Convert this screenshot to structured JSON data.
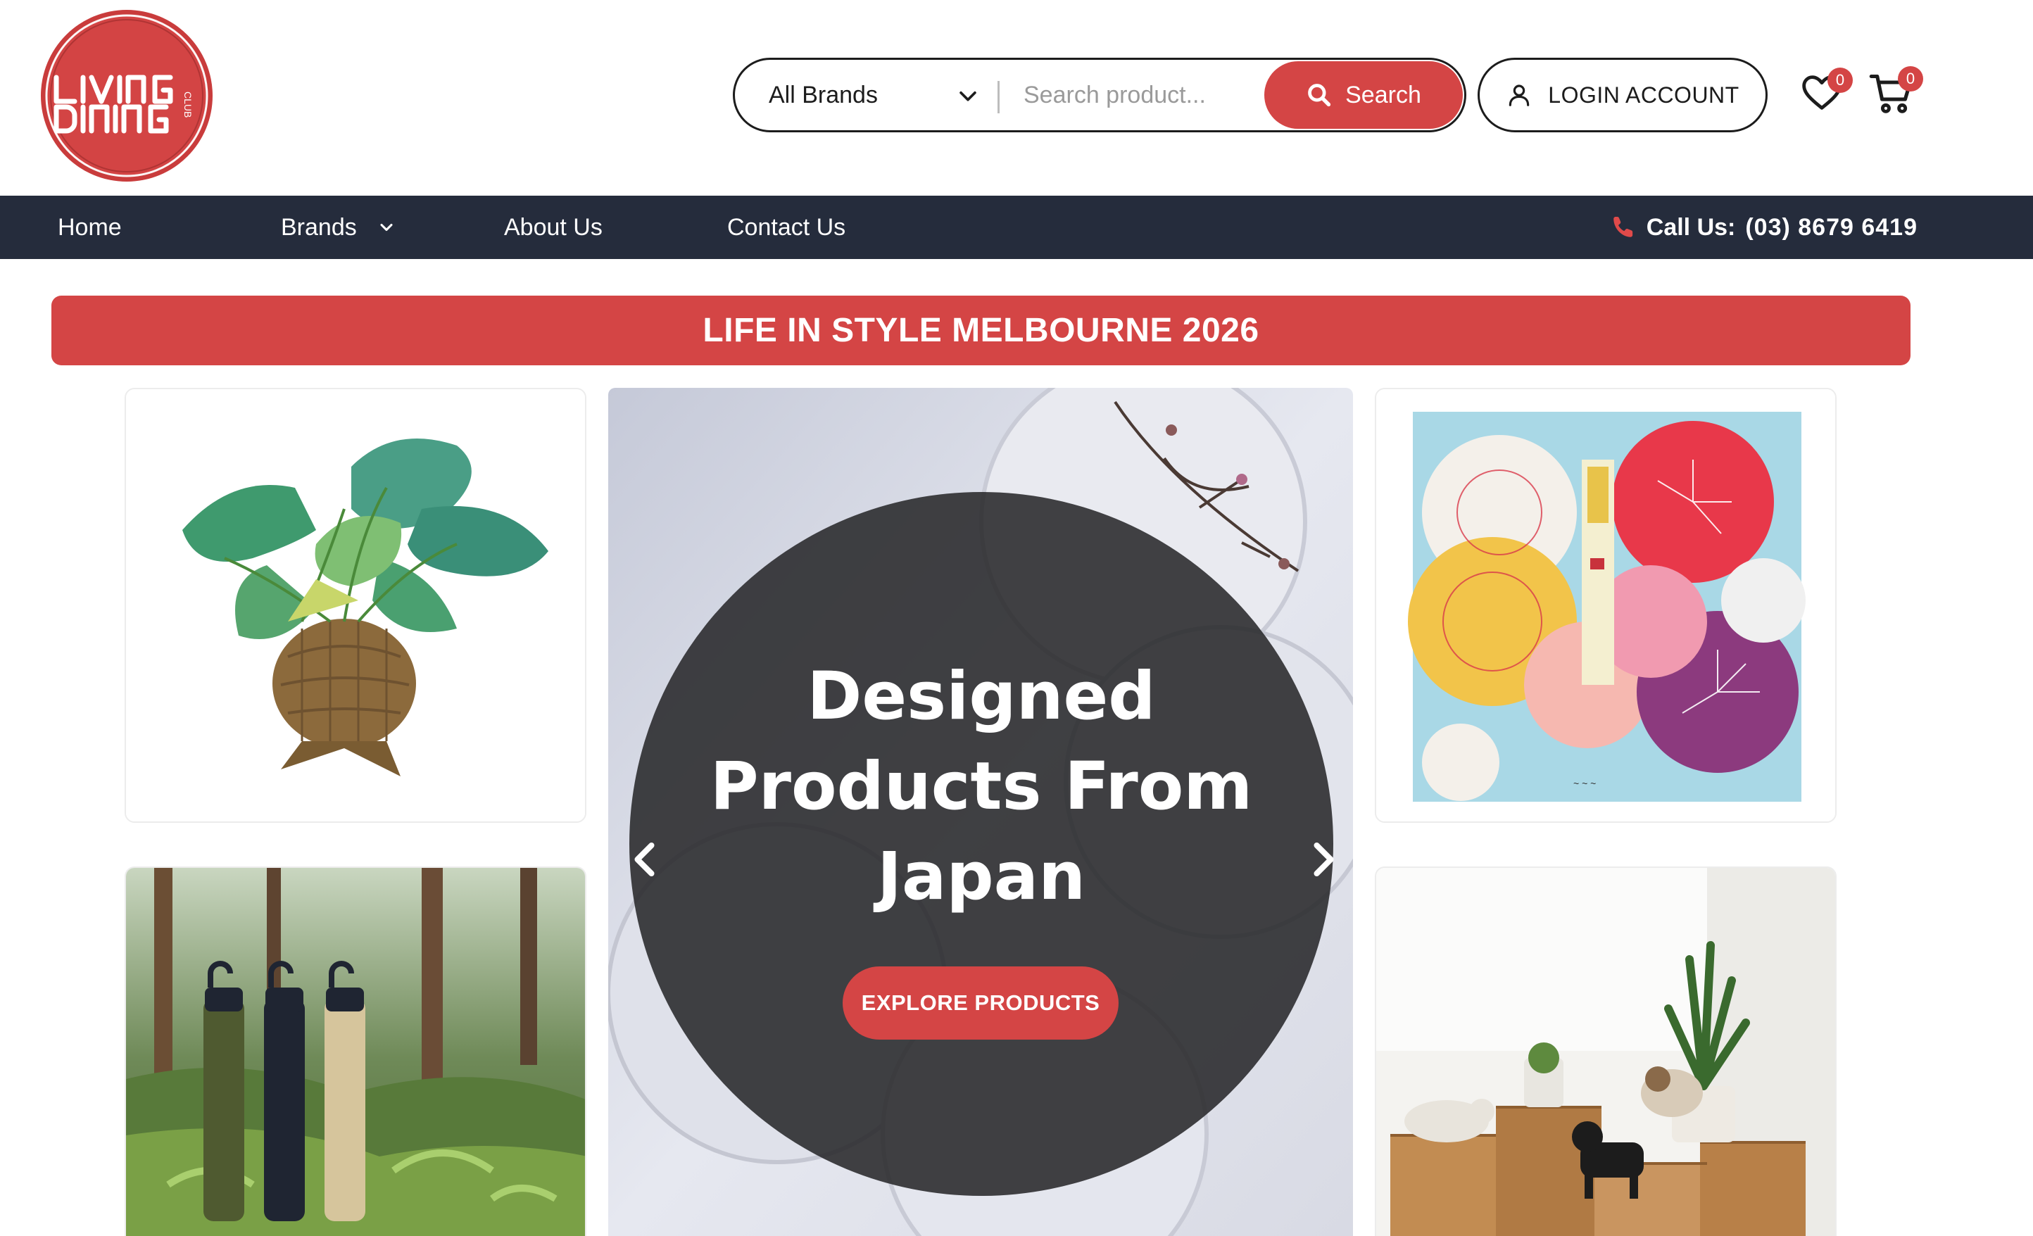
{
  "logo": {
    "text": "LIVING DINING",
    "sub": "CLUB"
  },
  "search": {
    "brand_selected": "All Brands",
    "placeholder": "Search product...",
    "button_label": "Search"
  },
  "account": {
    "login_label": "LOGIN ACCOUNT"
  },
  "wishlist": {
    "count": "0"
  },
  "cart": {
    "count": "0"
  },
  "nav": {
    "items": [
      {
        "label": "Home"
      },
      {
        "label": "Brands"
      },
      {
        "label": "About Us"
      },
      {
        "label": "Contact Us"
      }
    ],
    "phone_label": "Call Us:",
    "phone_number": "(03) 8679 6419"
  },
  "banner": {
    "text": "LIFE IN STYLE MELBOURNE 2026"
  },
  "hero": {
    "title_line1": "Designed",
    "title_line2": "Products From",
    "title_line3": "Japan",
    "cta_label": "EXPLORE PRODUCTS"
  },
  "colors": {
    "accent": "#d44545",
    "nav_bg": "#252c3c",
    "text": "#1c1c1c"
  },
  "icons": [
    "chevron-down-icon",
    "search-icon",
    "user-icon",
    "heart-icon",
    "cart-icon",
    "phone-icon",
    "chevron-left-icon",
    "chevron-right-icon"
  ]
}
